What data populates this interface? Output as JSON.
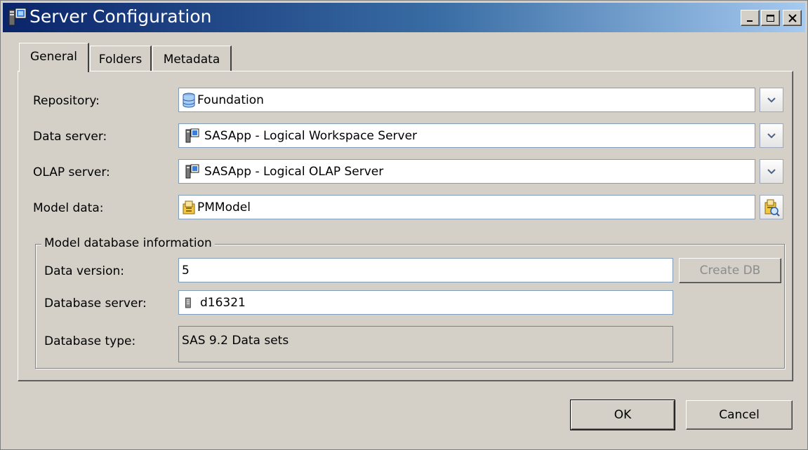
{
  "window": {
    "title": "Server Configuration",
    "icon": "server-config-icon",
    "controls": [
      "minimize-icon",
      "maximize-icon",
      "close-icon"
    ]
  },
  "tabs": [
    {
      "label": "General",
      "active": true
    },
    {
      "label": "Folders",
      "active": false
    },
    {
      "label": "Metadata",
      "active": false
    }
  ],
  "form": {
    "repository": {
      "label": "Repository:",
      "value": "Foundation",
      "icon": "database-icon"
    },
    "data_server": {
      "label": "Data server:",
      "value": "SASApp - Logical Workspace Server",
      "icon": "logical-server-icon"
    },
    "olap_server": {
      "label": "OLAP server:",
      "value": "SASApp - Logical OLAP Server",
      "icon": "logical-server-icon"
    },
    "model_data": {
      "label": "Model data:",
      "value": "PMModel",
      "icon": "model-folder-icon"
    }
  },
  "model_db": {
    "group_title": "Model database information",
    "data_version": {
      "label": "Data version:",
      "value": "5"
    },
    "create_db_label": "Create DB",
    "database_server": {
      "label": "Database server:",
      "value": "d16321",
      "icon": "server-tower-icon"
    },
    "database_type": {
      "label": "Database type:",
      "value": "SAS 9.2 Data sets"
    }
  },
  "buttons": {
    "ok": "OK",
    "cancel": "Cancel"
  },
  "colors": {
    "title_start": "#0a246a",
    "title_end": "#a6caf0",
    "face": "#d4d0c8",
    "field_border": "#7f9db9"
  }
}
